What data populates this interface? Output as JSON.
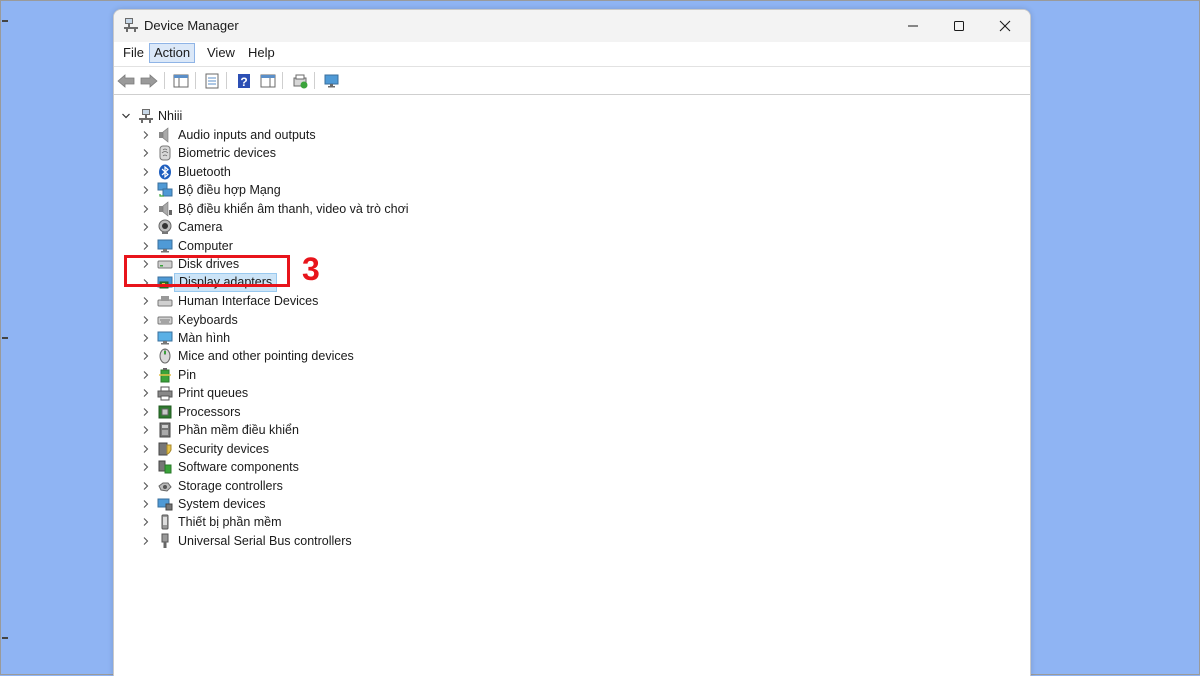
{
  "window": {
    "title": "Device Manager"
  },
  "menu": [
    {
      "label": "File",
      "active": false
    },
    {
      "label": "Action",
      "active": true
    },
    {
      "label": "View",
      "active": false
    },
    {
      "label": "Help",
      "active": false
    }
  ],
  "toolbar_icons": [
    "back-arrow-icon",
    "forward-arrow-icon",
    "show-hide-tree-icon",
    "properties-icon",
    "help-icon",
    "action-pane-icon",
    "update-driver-icon",
    "scan-hardware-icon"
  ],
  "tree": {
    "root": "Nhiii",
    "items": [
      {
        "label": "Audio inputs and outputs",
        "icon": "speaker-icon"
      },
      {
        "label": "Biometric devices",
        "icon": "fingerprint-icon"
      },
      {
        "label": "Bluetooth",
        "icon": "bluetooth-icon"
      },
      {
        "label": "Bộ điều hợp Mạng",
        "icon": "network-adapter-icon"
      },
      {
        "label": "Bộ điều khiển âm thanh, video và trò chơi",
        "icon": "sound-controller-icon"
      },
      {
        "label": "Camera",
        "icon": "camera-icon"
      },
      {
        "label": "Computer",
        "icon": "computer-icon"
      },
      {
        "label": "Disk drives",
        "icon": "disk-drive-icon"
      },
      {
        "label": "Display adapters",
        "icon": "display-adapter-icon",
        "selected": true
      },
      {
        "label": "Human Interface Devices",
        "icon": "hid-icon"
      },
      {
        "label": "Keyboards",
        "icon": "keyboard-icon"
      },
      {
        "label": "Màn hình",
        "icon": "monitor-icon"
      },
      {
        "label": "Mice and other pointing devices",
        "icon": "mouse-icon"
      },
      {
        "label": "Pin",
        "icon": "battery-icon"
      },
      {
        "label": "Print queues",
        "icon": "printer-icon"
      },
      {
        "label": "Processors",
        "icon": "processor-icon"
      },
      {
        "label": "Phần mềm điều khiển",
        "icon": "firmware-icon"
      },
      {
        "label": "Security devices",
        "icon": "security-device-icon"
      },
      {
        "label": "Software components",
        "icon": "software-component-icon"
      },
      {
        "label": "Storage controllers",
        "icon": "storage-controller-icon"
      },
      {
        "label": "System devices",
        "icon": "system-device-icon"
      },
      {
        "label": "Thiết bị phần mềm",
        "icon": "software-device-icon"
      },
      {
        "label": "Universal Serial Bus controllers",
        "icon": "usb-icon"
      }
    ]
  },
  "annotation": {
    "step_number": "3",
    "color": "#e8141b"
  },
  "colors": {
    "desktop": "#8fb4f3",
    "selection": "#cce4f7"
  }
}
